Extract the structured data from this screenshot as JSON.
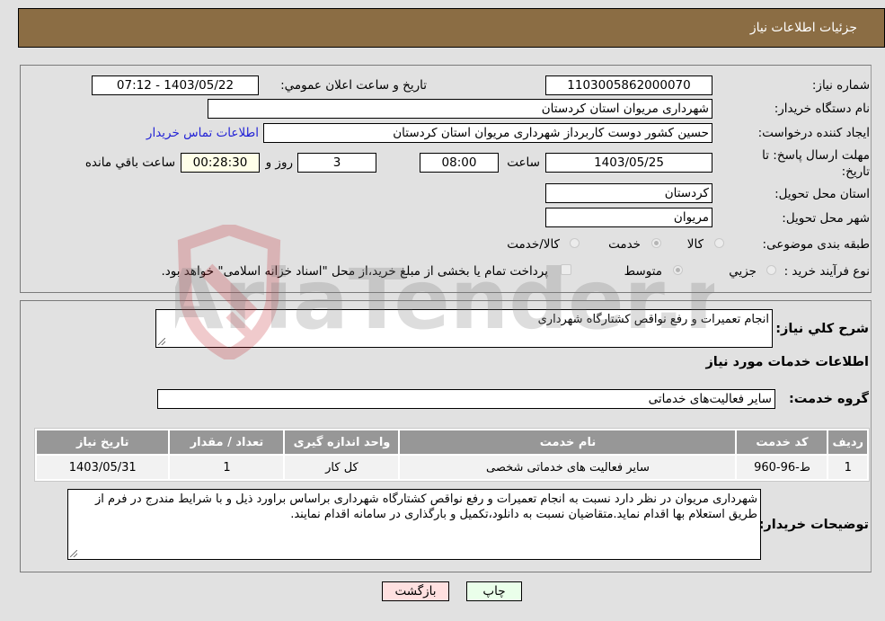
{
  "header": {
    "title": "جزئيات اطلاعات نياز"
  },
  "details": {
    "need_number": {
      "label": "شماره نياز:",
      "value": "1103005862000070"
    },
    "announce_datetime": {
      "label": "تاريخ و ساعت اعلان عمومي:",
      "value": "1403/05/22 - 07:12"
    },
    "buyer_org": {
      "label": "نام دستگاه خريدار:",
      "value": "شهرداری مریوان استان کردستان"
    },
    "requester": {
      "label": "ايجاد کننده درخواست:",
      "value": "حسین کشور دوست کاربرداز شهرداری مریوان استان کردستان",
      "contact_link": "اطلاعات تماس خريدار"
    },
    "deadline": {
      "label_line1": "مهلت ارسال پاسخ: تا",
      "label_line2": "تاريخ:",
      "date": "1403/05/25",
      "time_label": "ساعت",
      "time": "08:00",
      "days": "3",
      "days_label": "روز و",
      "remaining": "00:28:30",
      "remaining_label": "ساعت باقي مانده"
    },
    "delivery_province": {
      "label": "استان محل تحويل:",
      "value": "کردستان"
    },
    "delivery_city": {
      "label": "شهر محل تحويل:",
      "value": "مریوان"
    },
    "category": {
      "label": "طبقه بندی موضوعی:",
      "options": [
        {
          "label": "کالا",
          "selected": false
        },
        {
          "label": "خدمت",
          "selected": true
        },
        {
          "label": "کالا/خدمت",
          "selected": false
        }
      ]
    },
    "purchase_process": {
      "label": "نوع فرآيند خريد :",
      "options": [
        {
          "label": "جزيي",
          "selected": false
        },
        {
          "label": "متوسط",
          "selected": true
        }
      ],
      "treasury_checkbox": {
        "label": "پرداخت تمام يا بخشی از مبلغ خريد،از محل \"اسناد خزانه اسلامی\" خواهد بود.",
        "checked": false
      }
    }
  },
  "description": {
    "label": "شرح کلي نياز:",
    "value": "انجام تعمیرات و رفع نواقص کشتارگاه شهرداری"
  },
  "services": {
    "section_title": "اطلاعات خدمات مورد نياز",
    "group_label": "گروه خدمت:",
    "group_value": "سایر فعالیت‌های خدماتی",
    "table": {
      "columns": [
        "رديف",
        "کد خدمت",
        "نام خدمت",
        "واحد اندازه گيری",
        "تعداد / مقدار",
        "تاريخ نياز"
      ],
      "rows": [
        [
          "1",
          "ط-96-960",
          "سایر فعالیت های خدماتی شخصی",
          "کل کار",
          "1",
          "1403/05/31"
        ]
      ]
    }
  },
  "buyer_notes": {
    "label": "توضيحات خريدار:",
    "value": "شهرداری مریوان در نظر دارد نسبت به انجام تعمیرات و رفع نواقص کشتارگاه شهرداری براساس براورد ذیل و با شرایط مندرج در فرم از طریق استعلام بها اقدام نماید.متقاضیان نسبت به دانلود،تکمیل و بارگذاری در سامانه اقدام نمایند."
  },
  "buttons": {
    "print": "چاپ",
    "back": "بازگشت"
  },
  "watermark": {
    "text": "AriaTender.neT"
  },
  "colors": {
    "header_bg": "#8b6d44",
    "print_bg": "#eaffea",
    "back_bg": "#ffe0e0",
    "link": "#2323d6",
    "table_header": "#979797"
  }
}
